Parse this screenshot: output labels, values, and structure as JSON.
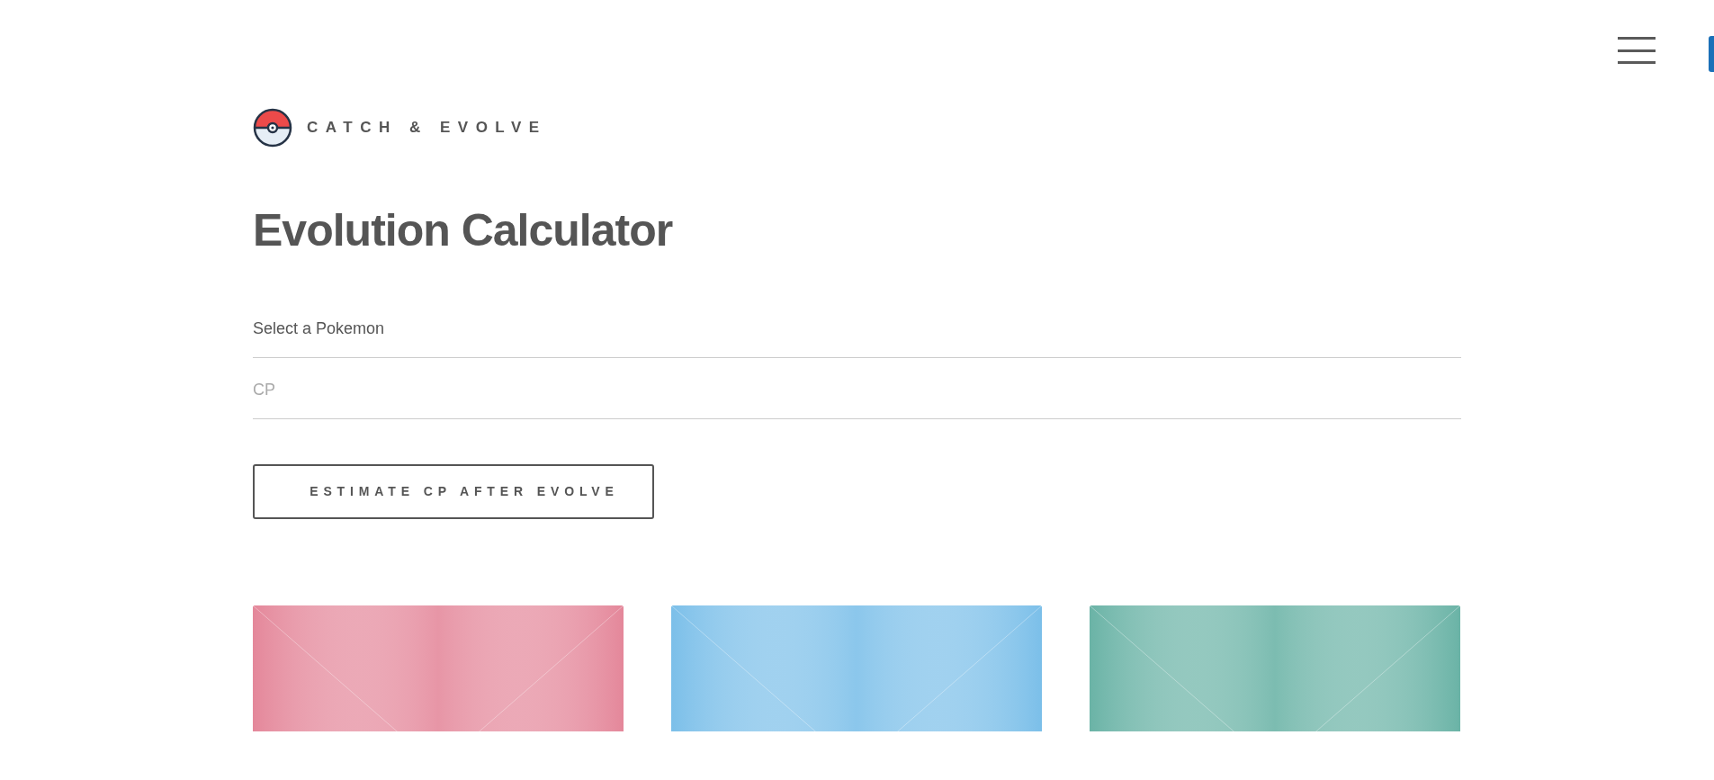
{
  "header": {
    "menu": {
      "kind": "hamburger"
    }
  },
  "brand": {
    "name": "CATCH & EVOLVE"
  },
  "title": "Evolution Calculator",
  "form": {
    "pokemon_select": {
      "value": "Select a Pokemon"
    },
    "cp_field": {
      "placeholder": "CP"
    },
    "submit": "ESTIMATE CP AFTER EVOLVE"
  },
  "cards": [
    {
      "color": "#e4879a"
    },
    {
      "color": "#7bbfe9"
    },
    {
      "color": "#6ab3a6"
    }
  ]
}
